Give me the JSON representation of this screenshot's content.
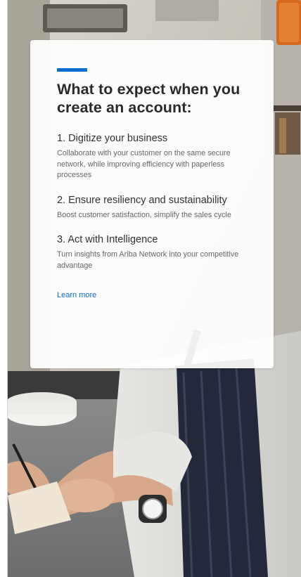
{
  "card": {
    "title": "What to expect when you create an account:",
    "steps": [
      {
        "heading": "1. Digitize your business",
        "description": "Collaborate with your customer on the same secure network, while improving efficiency with paperless processes"
      },
      {
        "heading": "2. Ensure resiliency and sustainability",
        "description": "Boost customer satisfaction, simplify the sales cycle"
      },
      {
        "heading": "3. Act with Intelligence",
        "description": "Turn insights from Ariba Network into your competitive advantage"
      }
    ],
    "learn_more": "Learn more"
  },
  "colors": {
    "accent": "#0a6ed1",
    "link": "#0a6ed1",
    "title": "#2a2a2a"
  }
}
